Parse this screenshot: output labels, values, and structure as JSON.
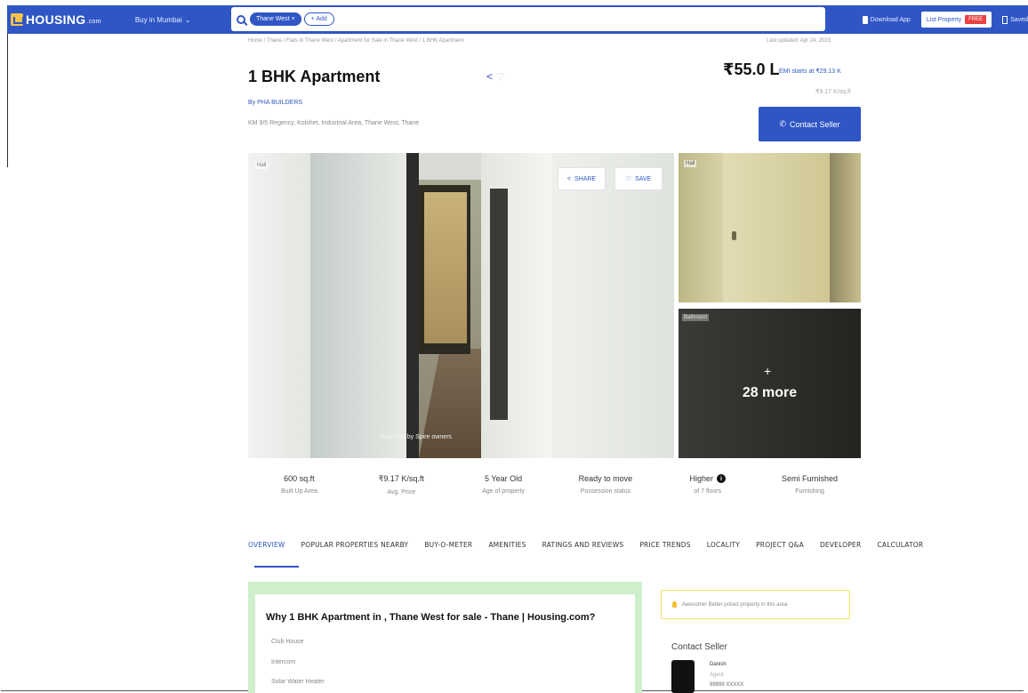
{
  "navbar": {
    "logo": "HOUSING",
    "logo_suffix": ".com",
    "city": "Buy in Mumbai",
    "search_chip": "Thane West",
    "add_chip": "+ Add",
    "download_app": "Download App",
    "list_property": "List Property",
    "free_badge": "FREE",
    "saved": "Saved"
  },
  "breadcrumb": "Home / Thane / Flats in Thane West / Apartment for Sale in Thane West / 1 BHK Apartment",
  "last_updated": "Last updated: Apr 24, 2023",
  "listing": {
    "title": "1 BHK Apartment",
    "price": "₹55.0 L",
    "emi": "EMI starts at ₹29.13 K",
    "price_per_sqft": "₹9.17 K/sq.ft",
    "builder": "By PHA BUILDERS",
    "address": "KM 9/5 Regency, Kolshet, Industrial Area, Thane West, Thane",
    "contact_button": "Contact Seller"
  },
  "gallery": {
    "main_tag": "Hall",
    "main_caption": "Reported by Spire owners",
    "share_label": "SHARE",
    "save_label": "SAVE",
    "top_tag": "Hall",
    "bottom_tag": "Bathroom",
    "more_plus": "+",
    "more_label": "28 more"
  },
  "stats": [
    {
      "value": "600 sq.ft",
      "label": "Built Up Area"
    },
    {
      "value": "₹9.17 K/sq.ft",
      "label": "Avg. Price"
    },
    {
      "value": "5 Year Old",
      "label": "Age of property"
    },
    {
      "value": "Ready to move",
      "label": "Possession status"
    },
    {
      "value": "Higher",
      "label": "of 7 floors"
    },
    {
      "value": "Semi Furnished",
      "label": "Furnishing"
    }
  ],
  "tabs": [
    "OVERVIEW",
    "POPULAR PROPERTIES NEARBY",
    "BUY-O-METER",
    "AMENITIES",
    "RATINGS AND REVIEWS",
    "PRICE TRENDS",
    "LOCALITY",
    "PROJECT Q&A",
    "DEVELOPER",
    "CALCULATOR"
  ],
  "why": {
    "title": "Why 1 BHK Apartment in , Thane West for sale - Thane | Housing.com?",
    "items": [
      "Club House",
      "Intercom",
      "Solar Water Heater"
    ]
  },
  "side": {
    "awareness": "Awesome! Better priced property in this area",
    "contact_heading": "Contact Seller",
    "seller_name": "Danish",
    "seller_role": "Agent",
    "seller_phone": "99999 XXXXX"
  },
  "colors": {
    "brand": "#2f56c4",
    "badge_red": "#e84141",
    "why_bg": "#cfeecb"
  }
}
